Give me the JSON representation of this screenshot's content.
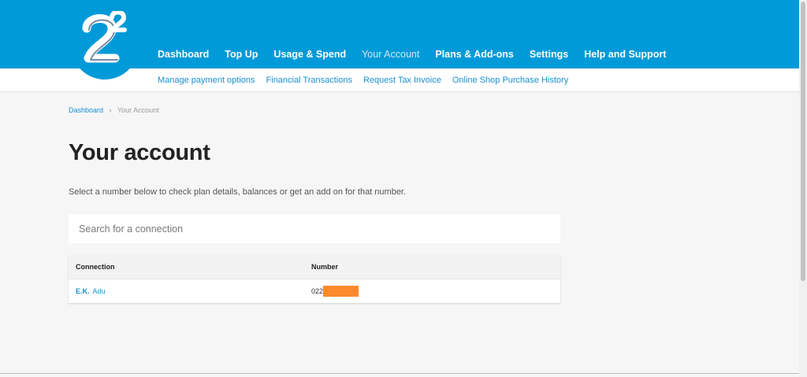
{
  "brand": {
    "logo_icon": "2degrees-logo-icon",
    "color": "#009ad8"
  },
  "nav": {
    "items": [
      {
        "label": "Dashboard",
        "active": false
      },
      {
        "label": "Top Up",
        "active": false
      },
      {
        "label": "Usage & Spend",
        "active": false
      },
      {
        "label": "Your Account",
        "active": true
      },
      {
        "label": "Plans & Add-ons",
        "active": false
      },
      {
        "label": "Settings",
        "active": false
      },
      {
        "label": "Help and Support",
        "active": false
      }
    ]
  },
  "subnav": {
    "items": [
      {
        "label": "Manage payment options"
      },
      {
        "label": "Financial Transactions"
      },
      {
        "label": "Request Tax Invoice"
      },
      {
        "label": "Online Shop Purchase History"
      }
    ]
  },
  "breadcrumb": {
    "home": "Dashboard",
    "separator": "›",
    "current": "Your Account"
  },
  "page": {
    "title": "Your account",
    "intro": "Select a number below to check plan details, balances or get an add on for that number."
  },
  "search": {
    "placeholder": "Search for a connection",
    "value": ""
  },
  "table": {
    "columns": [
      "Connection",
      "Number"
    ],
    "rows": [
      {
        "connection_first": "E.K.",
        "connection_last": "Adu",
        "number_prefix": "022",
        "redaction_color": "#fb8a2e"
      }
    ]
  }
}
